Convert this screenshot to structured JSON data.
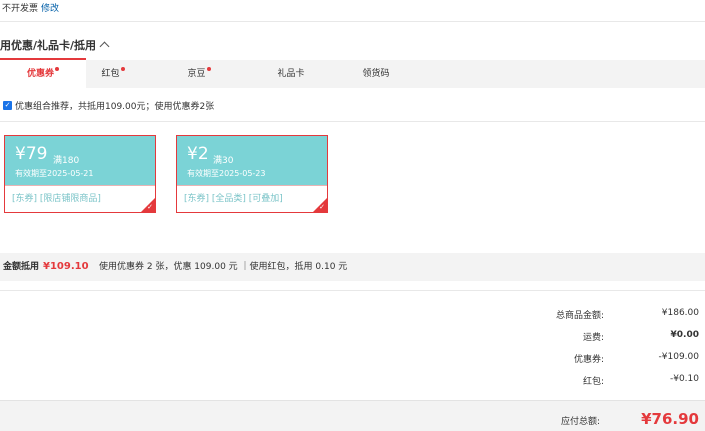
{
  "invoice": {
    "text": "不开发票",
    "edit_label": "修改"
  },
  "section": {
    "title": "用优惠/礼品卡/抵用"
  },
  "tabs": [
    {
      "label": "优惠券",
      "dot": true
    },
    {
      "label": "红包",
      "dot": true
    },
    {
      "label": "京豆",
      "dot": true
    },
    {
      "label": "礼品卡",
      "dot": false
    },
    {
      "label": "领货码",
      "dot": false
    }
  ],
  "recommend": {
    "text": "优惠组合推荐，共抵用109.00元；使用优惠券2张"
  },
  "coupons": [
    {
      "amount": "¥79",
      "condition": "满180",
      "valid": "有效期至2025-05-21",
      "tags": "[东券] [限店铺限商品]"
    },
    {
      "amount": "¥2",
      "condition": "满30",
      "valid": "有效期至2025-05-23",
      "tags": "[东券] [全品类] [可叠加]"
    }
  ],
  "summary": {
    "label": "金额抵用",
    "amount": "¥109.10",
    "detail": "使用优惠券 2 张，优惠 109.00 元 ｜使用红包，抵用 0.10 元"
  },
  "totals": [
    {
      "label": "总商品金额:",
      "value": "¥186.00",
      "bold": false
    },
    {
      "label": "运费:",
      "value": "¥0.00",
      "bold": true
    },
    {
      "label": "优惠券:",
      "value": "-¥109.00",
      "bold": false
    },
    {
      "label": "红包:",
      "value": "-¥0.10",
      "bold": false
    }
  ],
  "payable": {
    "label": "应付总额:",
    "value": "¥76.90"
  },
  "colors": {
    "accent": "#e4393c",
    "coupon_bg": "#7bd3d6",
    "link": "#005ea7"
  }
}
